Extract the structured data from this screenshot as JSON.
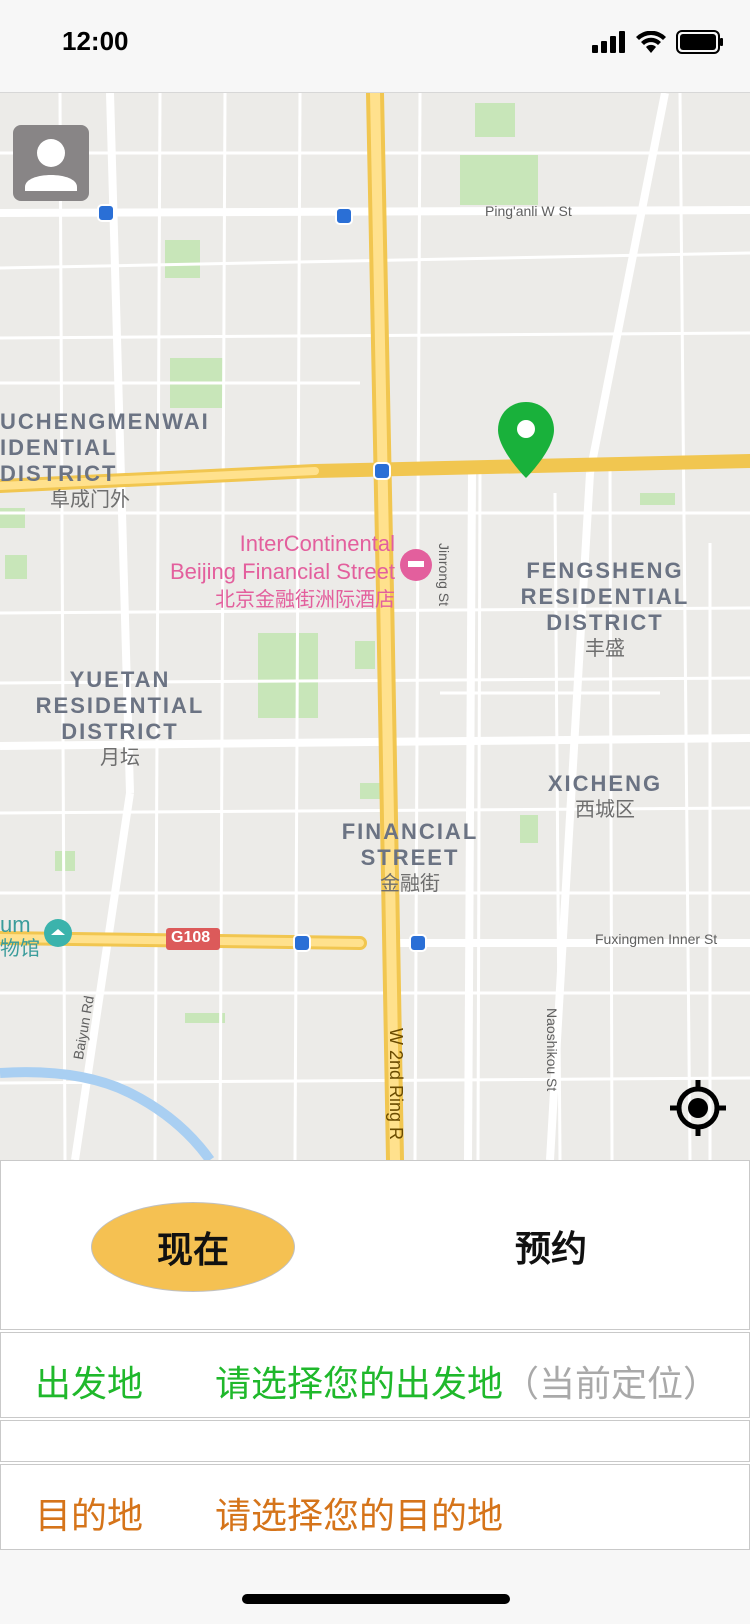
{
  "status": {
    "time": "12:00"
  },
  "map": {
    "districts": [
      {
        "name": "UCHENGMENWAI\nIDENTIAL DISTRICT",
        "cn": "阜成门外"
      },
      {
        "name": "FENGSHENG\nRESIDENTIAL\nDISTRICT",
        "cn": "丰盛"
      },
      {
        "name": "YUETAN\nRESIDENTIAL\nDISTRICT",
        "cn": "月坛"
      },
      {
        "name": "XICHENG",
        "cn": "西城区"
      },
      {
        "name": "FINANCIAL\nSTREET",
        "cn": "金融街"
      }
    ],
    "poi": {
      "line1": "InterContinental",
      "line2": "Beijing Financial Street",
      "line3": "北京金融街洲际酒店"
    },
    "roads": {
      "pinganli": "Ping'anli W St",
      "jinrong": "Jinrong St",
      "fuxingmen": "Fuxingmen Inner St",
      "baiyun": "Baiyun Rd",
      "w2nd": "W 2nd Ring R",
      "naoshikou": "Naoshikou St",
      "g108": "G108"
    },
    "museum": {
      "en": "um",
      "cn": "物馆"
    }
  },
  "modes": {
    "now": "现在",
    "reserve": "预约"
  },
  "start": {
    "label": "出发地",
    "value": "请选择您的出发地",
    "hint": "（当前定位）"
  },
  "dest": {
    "label": "目的地",
    "value": "请选择您的目的地"
  },
  "colors": {
    "accent_yellow": "#f5c152",
    "green": "#1fb82b",
    "orange": "#d5741a",
    "pin": "#19b13b"
  }
}
